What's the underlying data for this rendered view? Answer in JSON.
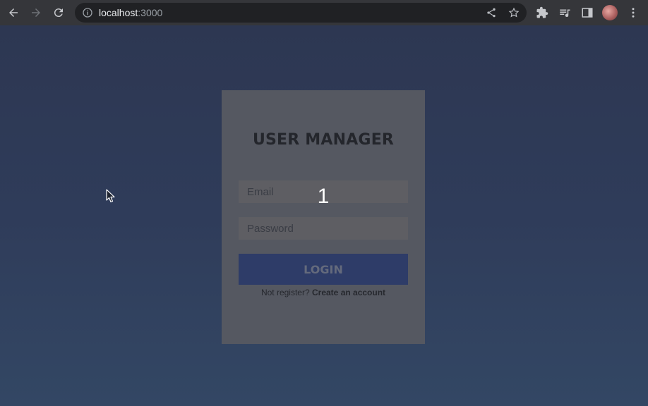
{
  "browser": {
    "url_host": "localhost",
    "url_port": ":3000",
    "icons": [
      "back-arrow-icon",
      "forward-arrow-icon",
      "reload-icon",
      "info-icon",
      "share-icon",
      "star-icon",
      "extensions-icon",
      "media-icon",
      "sidepanel-icon",
      "avatar",
      "menu-icon"
    ]
  },
  "login": {
    "title": "USER MANAGER",
    "email_placeholder": "Email",
    "password_placeholder": "Password",
    "login_label": "LOGIN",
    "register_prompt": "Not register?",
    "register_link": "Create an account"
  },
  "overlay": {
    "step_number": "1"
  },
  "colors": {
    "toolbar": "#35363a",
    "card": "#555861",
    "button": "#2e3c68",
    "page_top": "#2d3752",
    "page_bottom": "#334764"
  }
}
